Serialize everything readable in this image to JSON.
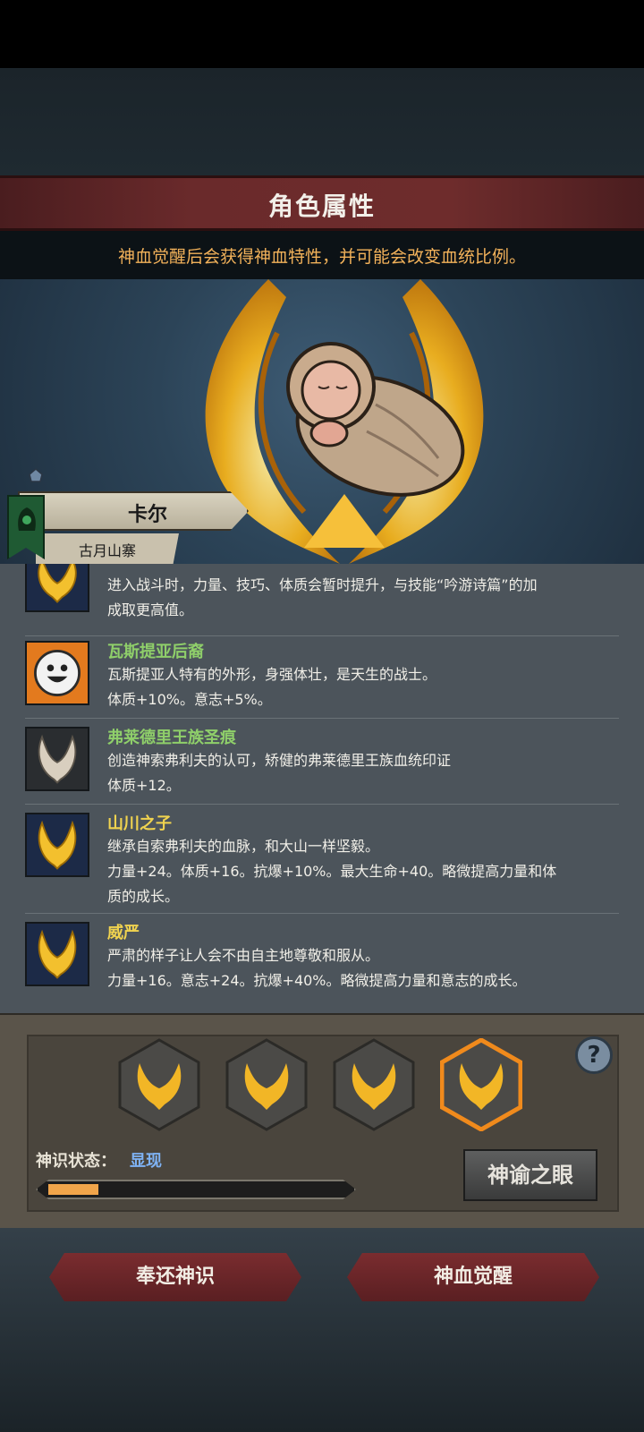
{
  "header": {
    "title": "角色属性",
    "subtitle": "神血觉醒后会获得神血特性，并可能会改变血统比例。"
  },
  "character": {
    "name": "卡尔",
    "origin": "古月山寨"
  },
  "traits": [
    {
      "name": "",
      "desc_lines": [
        "进入战斗时，力量、技巧、体质会暂时提升，与技能“吟游诗篇”的加",
        "成取更高值。"
      ],
      "name_color": "#8fcf6a",
      "icon": "golden-wings-icon"
    },
    {
      "name": "瓦斯提亚后裔",
      "desc_lines": [
        "瓦斯提亚人特有的外形，身强体壮，是天生的战士。",
        "体质+10%。意志+5%。"
      ],
      "name_color": "#8fcf6a",
      "icon": "smiling-face-icon"
    },
    {
      "name": "弗莱德里王族圣痕",
      "desc_lines": [
        "创造神索弗利夫的认可，矫健的弗莱德里王族血统印证",
        "体质+12。"
      ],
      "name_color": "#8fcf6a",
      "icon": "silver-horns-icon"
    },
    {
      "name": "山川之子",
      "desc_lines": [
        "继承自索弗利夫的血脉，和大山一样坚毅。",
        "力量+24。体质+16。抗爆+10%。最大生命+40。略微提高力量和体",
        "质的成长。"
      ],
      "name_color": "#f0d34f",
      "icon": "golden-wings-icon"
    },
    {
      "name": "威严",
      "desc_lines": [
        "严肃的样子让人会不由自主地尊敬和服从。",
        "力量+16。意志+24。抗爆+40%。略微提高力量和意志的成长。"
      ],
      "name_color": "#f0d34f",
      "icon": "golden-wings-icon"
    }
  ],
  "divine_slots": [
    {
      "icon": "divine-wings-icon",
      "selected": false
    },
    {
      "icon": "divine-wings-icon",
      "selected": false
    },
    {
      "icon": "divine-wings-icon",
      "selected": false
    },
    {
      "icon": "divine-wings-icon",
      "selected": true
    }
  ],
  "status": {
    "label": "神识状态：",
    "value": "显现",
    "progress": 0.17
  },
  "buttons": {
    "oracle": "神谕之眼",
    "help": "?",
    "return": "奉还神识",
    "awaken": "神血觉醒"
  },
  "colors": {
    "accent_orange": "#f1a54a",
    "status_blue": "#7fb3f5",
    "button_red": "#6e2628"
  }
}
